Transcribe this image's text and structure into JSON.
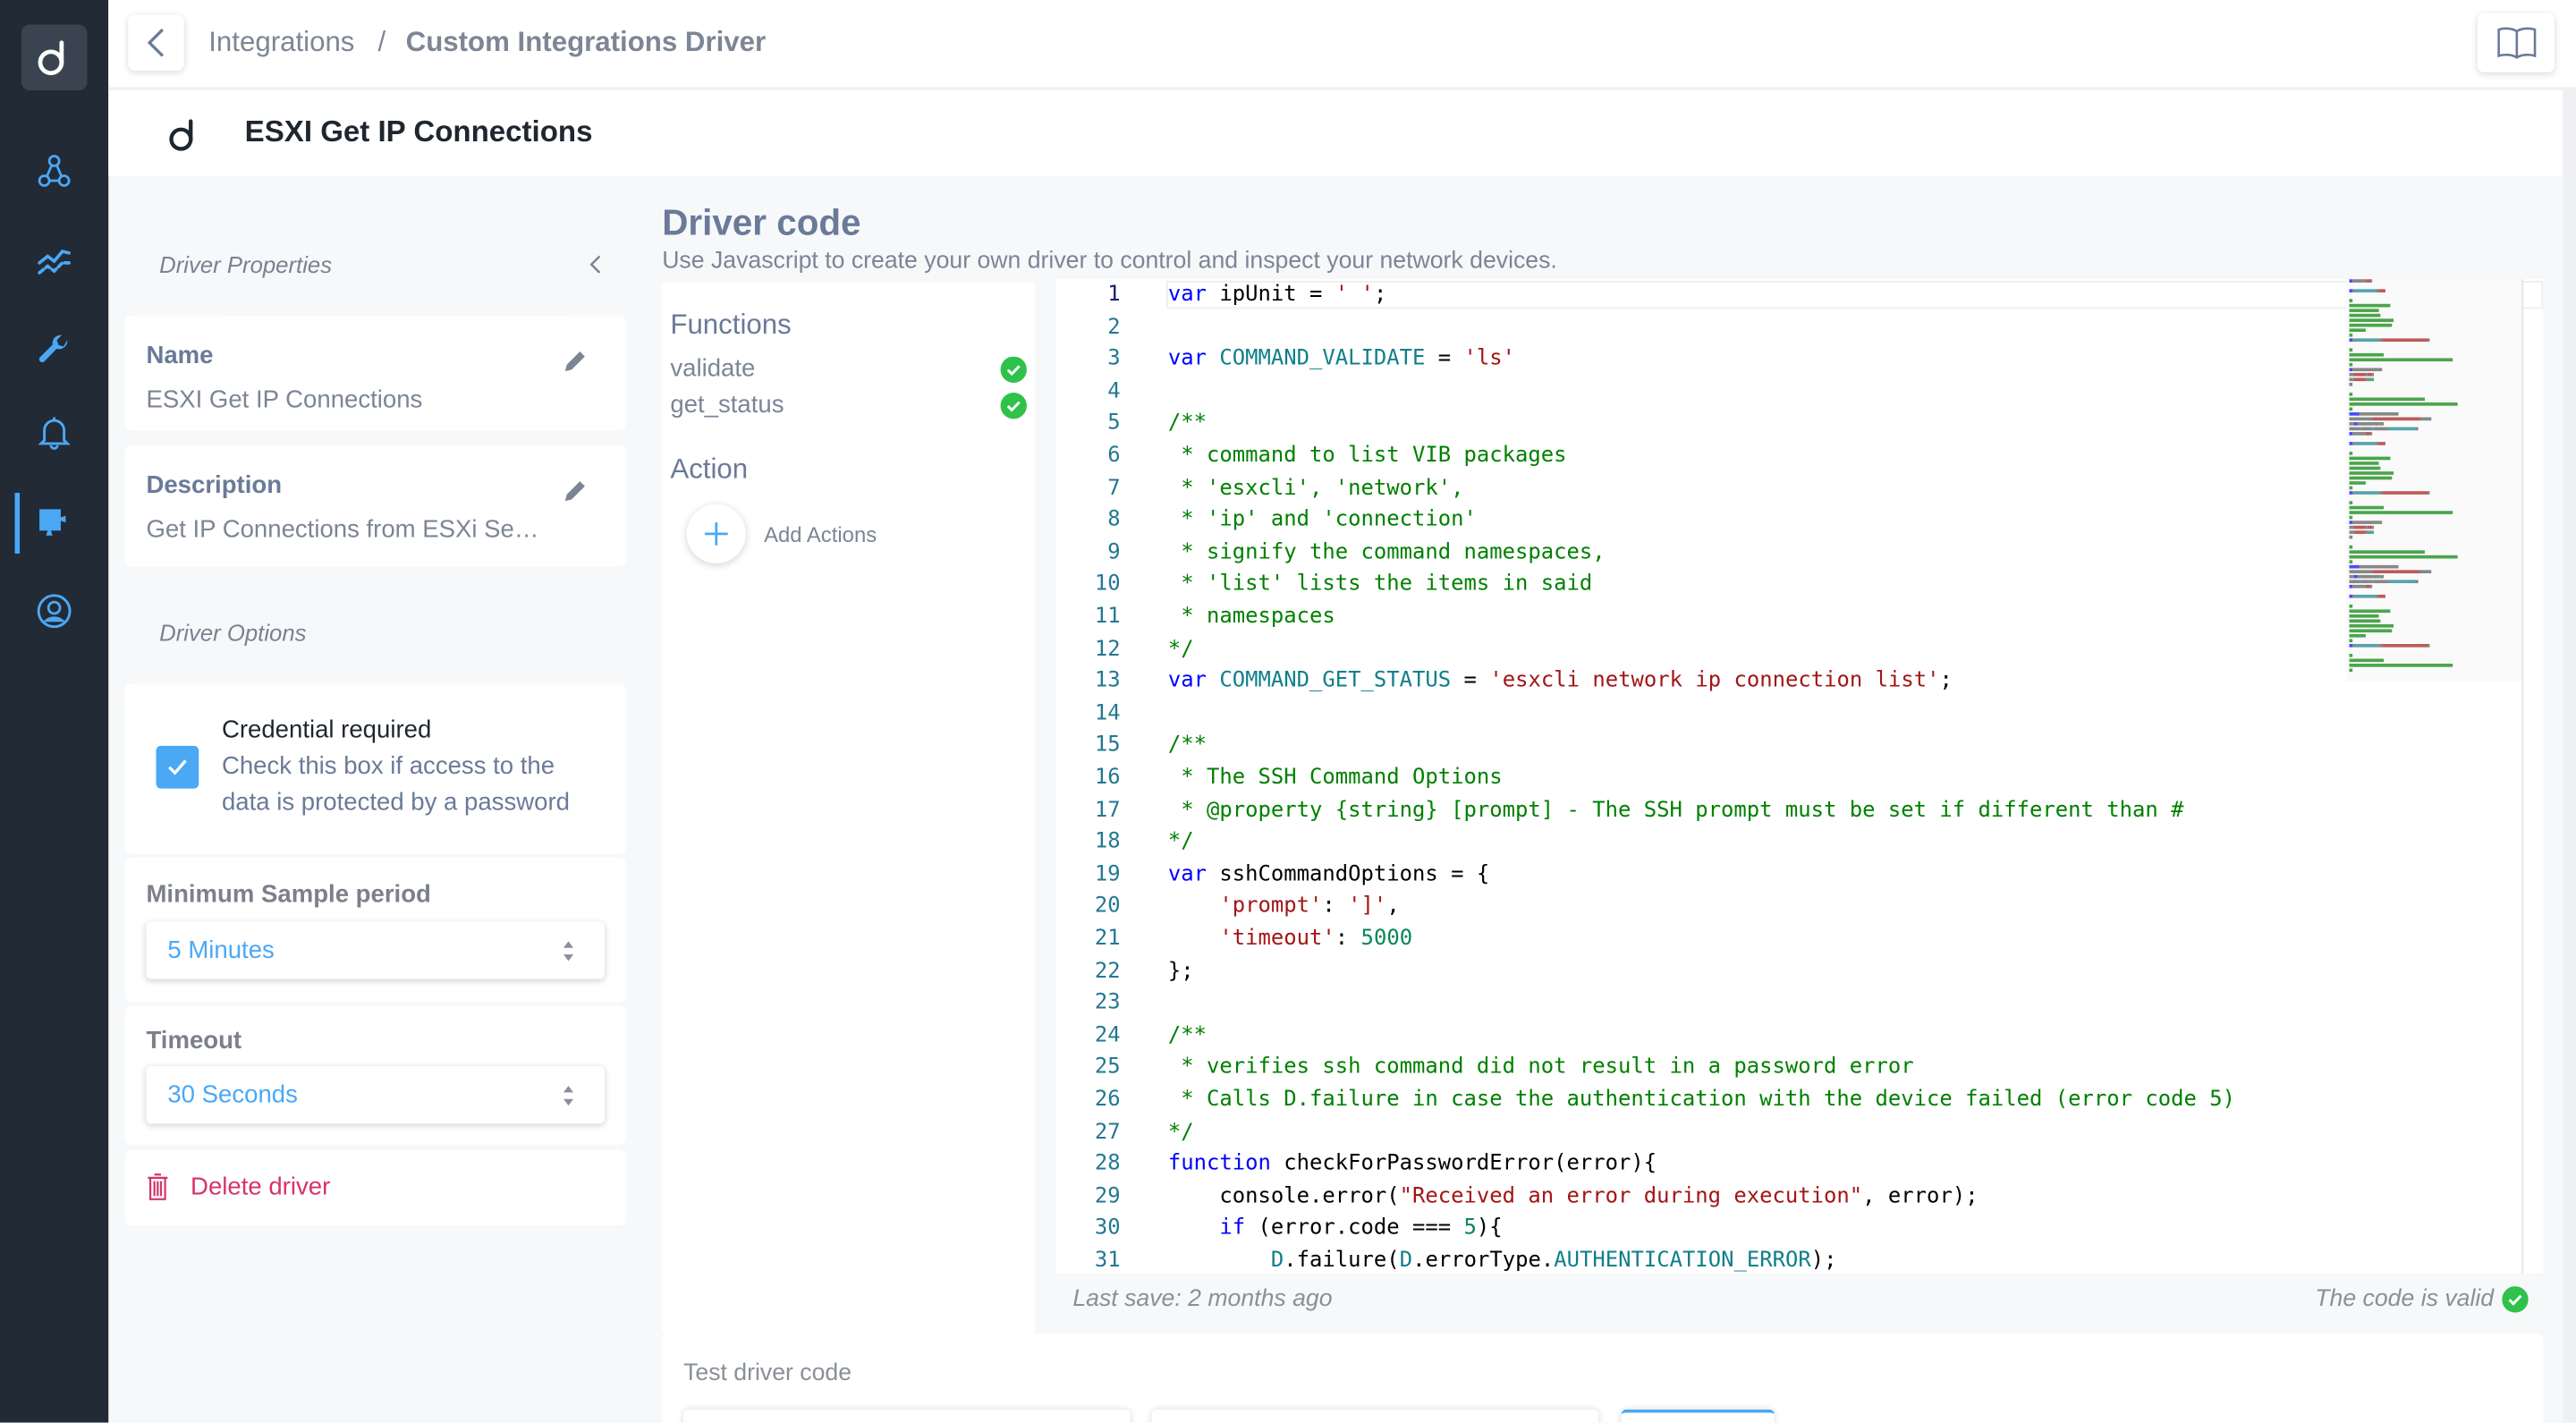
{
  "sidebar": {
    "logo": "d",
    "items": [
      {
        "name": "topology",
        "icon": "topology-icon"
      },
      {
        "name": "analytics",
        "icon": "trend-chart-icon"
      },
      {
        "name": "tools",
        "icon": "wrench-icon"
      },
      {
        "name": "alerts",
        "icon": "bell-icon"
      },
      {
        "name": "integrations",
        "icon": "puzzle-icon",
        "active": true
      },
      {
        "name": "account",
        "icon": "user-circle-icon"
      }
    ],
    "accent": "#4aa8f5"
  },
  "topbar": {
    "breadcrumb": [
      "Integrations",
      "Custom Integrations Driver"
    ],
    "separator": "/"
  },
  "header": {
    "title": "ESXI Get IP Connections"
  },
  "properties": {
    "section_title": "Driver Properties",
    "name_label": "Name",
    "name_value": "ESXI Get IP Connections",
    "description_label": "Description",
    "description_value": "Get IP Connections from ESXi Se…",
    "options_title": "Driver Options",
    "credential_title": "Credential required",
    "credential_desc_1": "Check this box if access to the",
    "credential_desc_2": "data is protected by a password",
    "credential_checked": true,
    "sample_label": "Minimum Sample period",
    "sample_value": "5 Minutes",
    "timeout_label": "Timeout",
    "timeout_value": "30 Seconds",
    "delete_label": "Delete driver"
  },
  "main": {
    "title": "Driver code",
    "subtitle": "Use Javascript to create your own driver to control and inspect your network devices.",
    "functions_title": "Functions",
    "functions": [
      {
        "name": "validate",
        "valid": true
      },
      {
        "name": "get_status",
        "valid": true
      }
    ],
    "action_title": "Action",
    "add_actions": "Add Actions",
    "last_save": "Last save: 2 months ago",
    "code_status": "The code is valid",
    "test_title": "Test driver code"
  },
  "code": [
    [
      [
        "k",
        "var"
      ],
      [
        "i",
        " ipUnit = "
      ],
      [
        "s",
        "' '"
      ],
      [
        "i",
        ";"
      ]
    ],
    [],
    [
      [
        "k",
        "var"
      ],
      [
        "i",
        " "
      ],
      [
        "c",
        "COMMAND_VALIDATE"
      ],
      [
        "i",
        " = "
      ],
      [
        "s",
        "'ls'"
      ]
    ],
    [],
    [
      [
        "m",
        "/**"
      ]
    ],
    [
      [
        "m",
        " * command to list VIB packages"
      ]
    ],
    [
      [
        "m",
        " * 'esxcli', 'network',"
      ]
    ],
    [
      [
        "m",
        " * 'ip' and 'connection'"
      ]
    ],
    [
      [
        "m",
        " * signify the command namespaces,"
      ]
    ],
    [
      [
        "m",
        " * 'list' lists the items in said"
      ]
    ],
    [
      [
        "m",
        " * namespaces"
      ]
    ],
    [
      [
        "m",
        "*/"
      ]
    ],
    [
      [
        "k",
        "var"
      ],
      [
        "i",
        " "
      ],
      [
        "c",
        "COMMAND_GET_STATUS"
      ],
      [
        "i",
        " = "
      ],
      [
        "s",
        "'esxcli network ip connection list'"
      ],
      [
        "i",
        ";"
      ]
    ],
    [],
    [
      [
        "m",
        "/**"
      ]
    ],
    [
      [
        "m",
        " * The SSH Command Options"
      ]
    ],
    [
      [
        "m",
        " * @property {string} [prompt] - The SSH prompt must be set if different than #"
      ]
    ],
    [
      [
        "m",
        "*/"
      ]
    ],
    [
      [
        "k",
        "var"
      ],
      [
        "i",
        " sshCommandOptions = {"
      ]
    ],
    [
      [
        "i",
        "    "
      ],
      [
        "s",
        "'prompt'"
      ],
      [
        "i",
        ": "
      ],
      [
        "s",
        "']'"
      ],
      [
        "i",
        ","
      ]
    ],
    [
      [
        "i",
        "    "
      ],
      [
        "s",
        "'timeout'"
      ],
      [
        "i",
        ": "
      ],
      [
        "n",
        "5000"
      ]
    ],
    [
      [
        "i",
        "};"
      ]
    ],
    [],
    [
      [
        "m",
        "/**"
      ]
    ],
    [
      [
        "m",
        " * verifies ssh command did not result in a password error"
      ]
    ],
    [
      [
        "m",
        " * Calls D.failure in case the authentication with the device failed (error code 5)"
      ]
    ],
    [
      [
        "m",
        "*/"
      ]
    ],
    [
      [
        "k",
        "function"
      ],
      [
        "i",
        " checkForPasswordError(error){"
      ]
    ],
    [
      [
        "i",
        "    console.error("
      ],
      [
        "s",
        "\"Received an error during execution\""
      ],
      [
        "i",
        ", error);"
      ]
    ],
    [
      [
        "i",
        "    "
      ],
      [
        "k",
        "if"
      ],
      [
        "i",
        " (error.code === "
      ],
      [
        "n",
        "5"
      ],
      [
        "i",
        "){"
      ]
    ],
    [
      [
        "i",
        "        "
      ],
      [
        "c",
        "D"
      ],
      [
        "i",
        ".failure("
      ],
      [
        "c",
        "D"
      ],
      [
        "i",
        ".errorType."
      ],
      [
        "c",
        "AUTHENTICATION_ERROR"
      ],
      [
        "i",
        ");"
      ]
    ]
  ],
  "colors": {
    "valid": "#2fc24a",
    "danger": "#d6336c",
    "accent": "#4aa8f5"
  }
}
